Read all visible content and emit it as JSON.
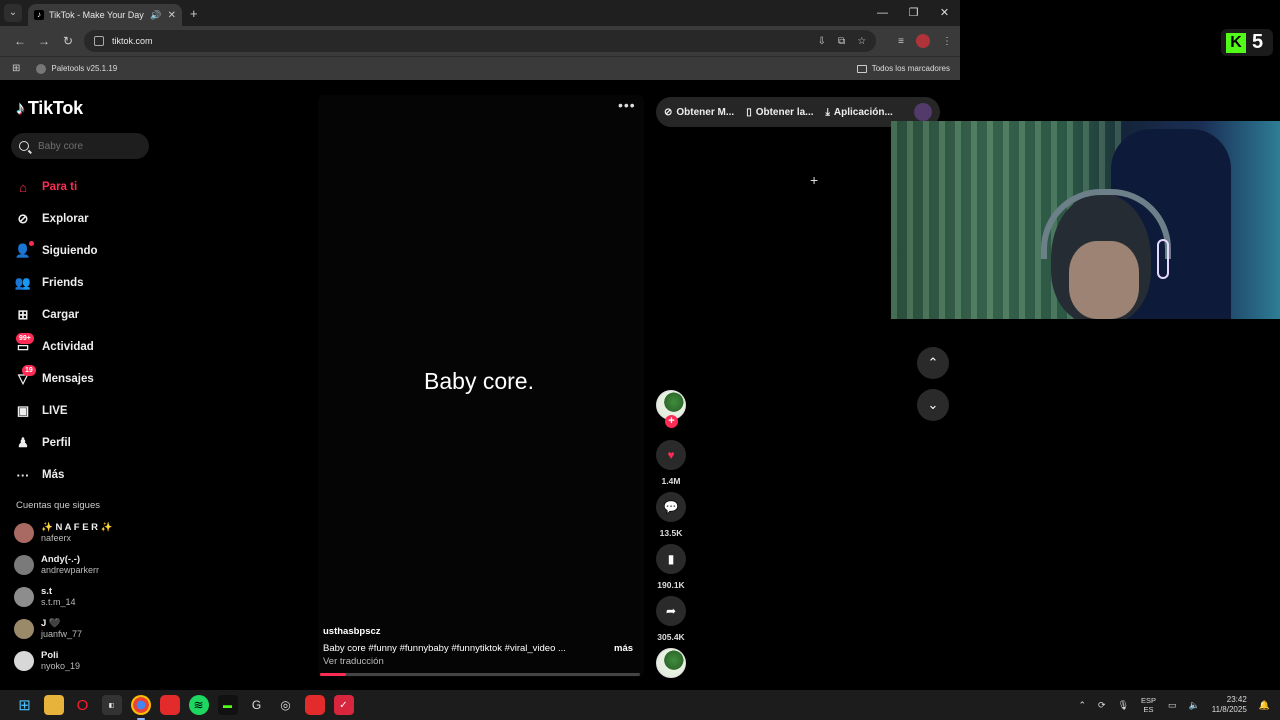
{
  "browser": {
    "tab_title": "TikTok - Make Your Day",
    "url": "tiktok.com",
    "bookmark": "Paletools v25.1.19",
    "all_bookmarks": "Todos los marcadores"
  },
  "tiktok": {
    "logo": "TikTok",
    "search_placeholder": "Baby core",
    "nav": [
      {
        "label": "Para ti",
        "icon": "home-icon"
      },
      {
        "label": "Explorar",
        "icon": "compass-icon"
      },
      {
        "label": "Siguiendo",
        "icon": "following-icon"
      },
      {
        "label": "Friends",
        "icon": "friends-icon"
      },
      {
        "label": "Cargar",
        "icon": "upload-icon"
      },
      {
        "label": "Actividad",
        "icon": "inbox-icon",
        "badge": "99+"
      },
      {
        "label": "Mensajes",
        "icon": "messages-icon",
        "badge": "19"
      },
      {
        "label": "LIVE",
        "icon": "live-icon"
      },
      {
        "label": "Perfil",
        "icon": "profile-icon"
      },
      {
        "label": "Más",
        "icon": "more-icon"
      }
    ],
    "following_title": "Cuentas que sigues",
    "following": [
      {
        "name": "✨ N A F E R ✨",
        "handle": "nafeerx"
      },
      {
        "name": "Andy(-.-)",
        "handle": "andrewparkerr"
      },
      {
        "name": "s.t",
        "handle": "s.t.m_14"
      },
      {
        "name": "J 🖤",
        "handle": "juanfw_77"
      },
      {
        "name": "Poli",
        "handle": "nyoko_19"
      }
    ],
    "video": {
      "caption_big": "Baby core.",
      "username": "usthasbpscz",
      "description": "Baby core #funny  #funnybaby  #funnytiktok  #viral_video  ...",
      "more": "más",
      "translate": "Ver traducción",
      "progress": 0.08
    },
    "actions": {
      "likes": "1.4M",
      "comments": "13.5K",
      "saves": "190.1K",
      "shares": "305.4K"
    },
    "topbar": {
      "coins": "Obtener M...",
      "app": "Obtener la...",
      "download": "Aplicación..."
    }
  },
  "overlay": {
    "kick_count": "5"
  },
  "taskbar": {
    "lang_top": "ESP",
    "lang_bottom": "ES",
    "time": "23:42",
    "date": "11/8/2025"
  },
  "colors": {
    "accent": "#fe2c55",
    "kick": "#53fc18"
  }
}
